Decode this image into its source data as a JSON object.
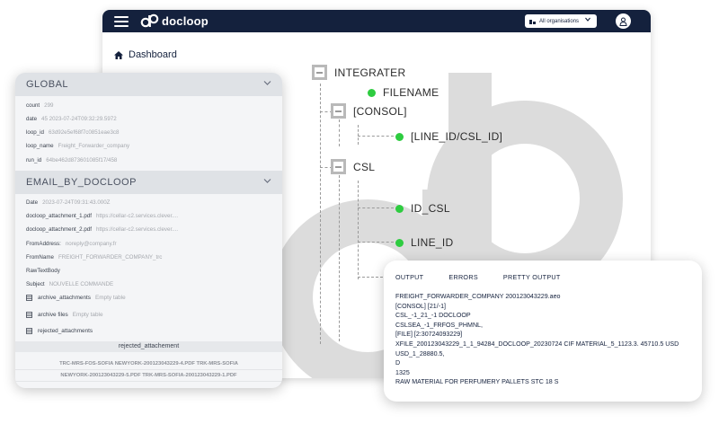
{
  "app": {
    "logo_text": "docloop",
    "org_select_value": "All organisations",
    "breadcrumb": "Dashboard"
  },
  "tree": {
    "root": "INTEGRATER",
    "filename": "FILENAME",
    "consol": "[CONSOL]",
    "line_id_csl_id": "[LINE_ID/CSL_ID]",
    "csl": "CSL",
    "id_csl": "ID_CSL",
    "line_id": "LINE_ID"
  },
  "global": {
    "title": "GLOBAL",
    "fields": [
      {
        "key": "count",
        "value": "299"
      },
      {
        "key": "date",
        "value": "45 2023-07-24T09:32:29.5972"
      },
      {
        "key": "loop_id",
        "value": "63d92e5ef68f7c0851eae3c8"
      },
      {
        "key": "loop_name",
        "value": "Freight_Forwarder_company"
      },
      {
        "key": "run_id",
        "value": "64be462d873601085f17/458"
      }
    ]
  },
  "email": {
    "title": "EMAIL_BY_DOCLOOP",
    "fields": [
      {
        "key": "Date",
        "value": "2023-07-24T09:31:43.000Z"
      },
      {
        "key": "docloop_attachment_1.pdf",
        "value": "https://cellar-c2.services.clever...."
      },
      {
        "key": "docloop_attachment_2.pdf",
        "value": "https://cellar-c2.services.clever...."
      },
      {
        "key": "FromAddress:",
        "value": "noreply@company.fr"
      },
      {
        "key": "FromName",
        "value": "FREIGHT_FORWARDER_COMPANY_trc"
      },
      {
        "key": "RawTextBody",
        "value": ""
      },
      {
        "key": "Subject",
        "value": "NOUVELLE COMMANDE"
      }
    ],
    "tables": [
      {
        "key": "archive_attachments",
        "value": "Empty table"
      },
      {
        "key": "archive files",
        "value": "Empty table"
      },
      {
        "key": "rejected_attachments",
        "value": ""
      }
    ],
    "rejected_header": "rejected_attachement",
    "rejected_rows": [
      "TRC-MRS-FOS-SOFIA NEWYORK-200123043229-4.PDF TRK-MRS-SOFIA",
      "NEWYORK-200123043229-5.PDF TRK-MRS-SOFIA-200123043229-1.PDF"
    ]
  },
  "output": {
    "tabs": [
      "OUTPUT",
      "ERRORS",
      "PRETTY OUTPUT"
    ],
    "lines": [
      "FREIGHT_FORWARDER_COMPANY 200123043229.aeo",
      "[CONSOL] [21/-1]",
      "CSL_-1_21_-1 DOCLOOP",
      "CSLSEA_-1_FRFOS_PHMNL,",
      "[FILE] [2:30724093229]",
      "XFILE_200123043229_1_1_94284_DOCLOOP_20230724 CIF MATERIAL_5_1123.3. 45710.5 USD",
      "USD_1_28880.5,",
      "D",
      "1325",
      "RAW MATERIAL FOR PERFUMERY PALLETS STC 18 S"
    ]
  },
  "colors": {
    "navy": "#14213d",
    "green_dot": "#2ecc40",
    "panel_bg": "#f4f5f7",
    "section_header": "#dfe2e6"
  },
  "icons": [
    "menu-icon",
    "docloop-logo-icon",
    "organisation-icon",
    "chevron-down-icon",
    "user-icon",
    "home-icon",
    "minus-icon",
    "table-icon"
  ]
}
